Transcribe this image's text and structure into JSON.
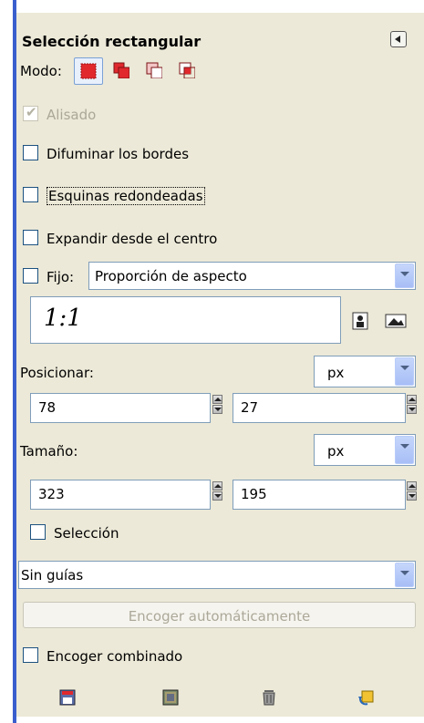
{
  "panel": {
    "title": "Selección rectangular",
    "mode_label": "Modo:",
    "antialias_label": "Alisado",
    "feather_label": "Difuminar los bordes",
    "rounded_label": "Esquinas redondeadas",
    "expand_label": "Expandir desde el centro",
    "fixed_label": "Fijo:",
    "fixed_mode_value": "Proporción de aspecto",
    "aspect_value": "1:1",
    "position_label": "Posicionar:",
    "position_unit": "px",
    "position_x": "78",
    "position_y": "27",
    "size_label": "Tamaño:",
    "size_unit": "px",
    "size_w": "323",
    "size_h": "195",
    "highlight_label": "Selección",
    "guides_value": "Sin guías",
    "autoshrink_label": "Encoger automáticamente",
    "shrink_merged_label": "Encoger combinado"
  },
  "state": {
    "antialias_checked": true,
    "antialias_enabled": false,
    "feather_checked": false,
    "rounded_checked": false,
    "expand_checked": false,
    "fixed_checked": false,
    "highlight_checked": false,
    "shrink_merged_checked": false
  },
  "icons": {
    "mode": [
      "replace-mode-icon",
      "add-mode-icon",
      "subtract-mode-icon",
      "intersect-mode-icon"
    ],
    "aspect": [
      "portrait-icon",
      "landscape-icon"
    ],
    "bottom": [
      "save-preset-icon",
      "restore-preset-icon",
      "delete-preset-icon",
      "reset-icon"
    ]
  },
  "colors": {
    "panel_bg": "#ece9d8",
    "accent_blue": "#3a5fcd",
    "mode_red": "#e0282d"
  }
}
